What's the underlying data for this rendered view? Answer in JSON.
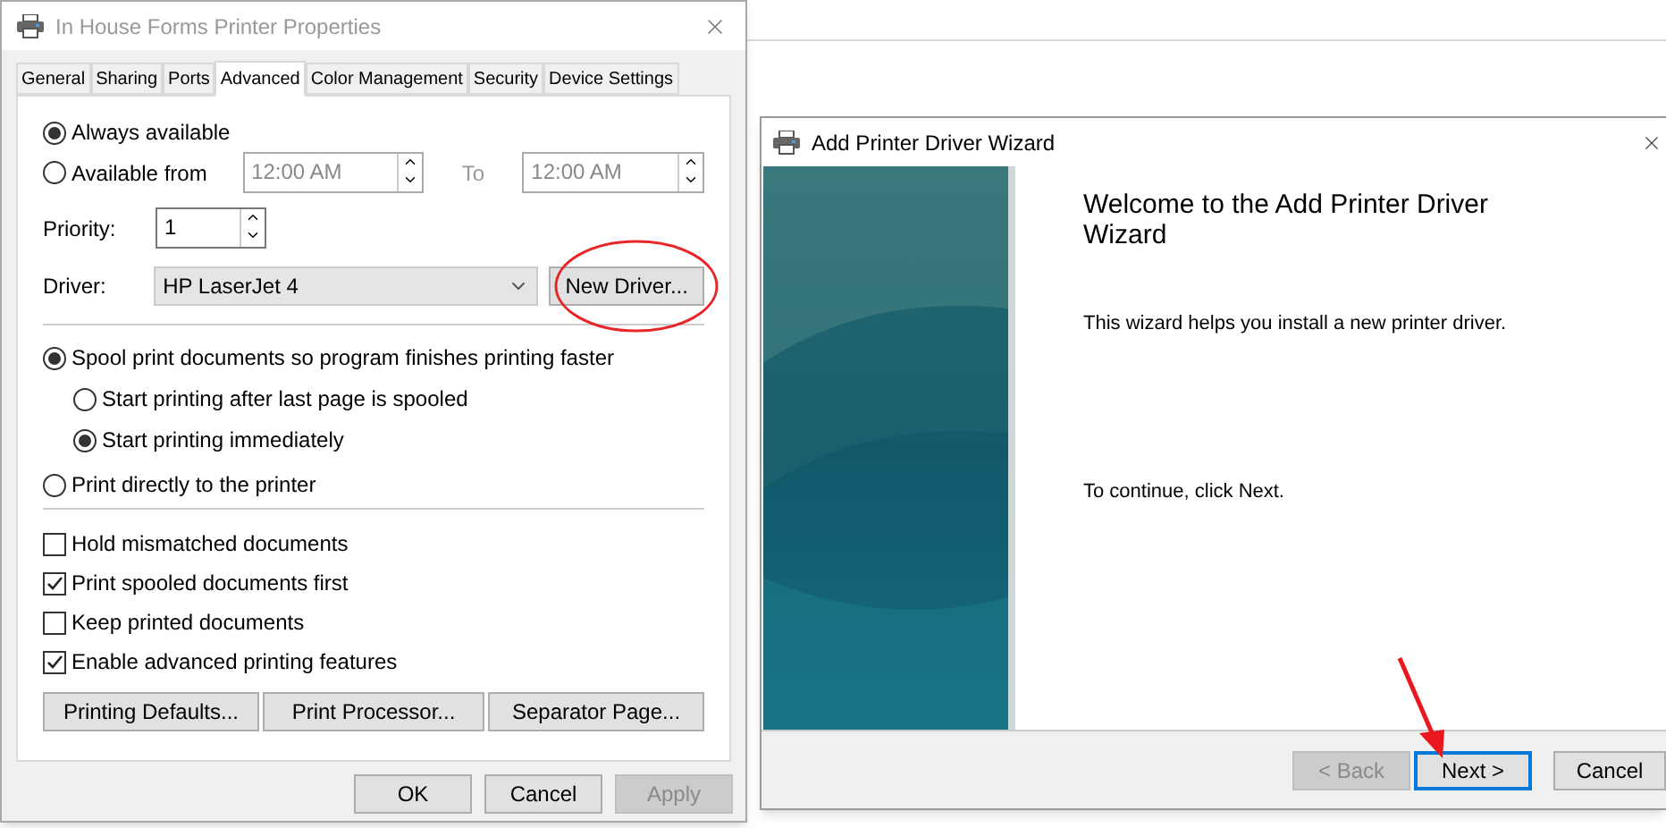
{
  "properties_window": {
    "title": "In House Forms Printer Properties",
    "tabs": [
      {
        "label": "General",
        "selected": false
      },
      {
        "label": "Sharing",
        "selected": false
      },
      {
        "label": "Ports",
        "selected": false
      },
      {
        "label": "Advanced",
        "selected": true
      },
      {
        "label": "Color Management",
        "selected": false
      },
      {
        "label": "Security",
        "selected": false
      },
      {
        "label": "Device Settings",
        "selected": false
      }
    ],
    "availability": [
      {
        "label": "Always available",
        "selected": true
      },
      {
        "label": "Available from",
        "selected": false
      }
    ],
    "from_time": "12:00 AM",
    "to_label": "To",
    "to_time": "12:00 AM",
    "priority_label": "Priority:",
    "priority": "1",
    "driver_label": "Driver:",
    "driver": "HP LaserJet 4",
    "new_driver_button": "New Driver...",
    "spool_options": [
      {
        "label": "Spool print documents so program finishes printing faster",
        "selected": true,
        "children": [
          {
            "label": "Start printing after last page is spooled",
            "selected": false
          },
          {
            "label": "Start printing immediately",
            "selected": true
          }
        ]
      },
      {
        "label": "Print directly to the printer",
        "selected": false
      }
    ],
    "checkboxes": [
      {
        "label": "Hold mismatched documents",
        "checked": false
      },
      {
        "label": "Print spooled documents first",
        "checked": true
      },
      {
        "label": "Keep printed documents",
        "checked": false
      },
      {
        "label": "Enable advanced printing features",
        "checked": true
      }
    ],
    "action_buttons": [
      "Printing Defaults...",
      "Print Processor...",
      "Separator Page..."
    ],
    "footer_buttons": [
      {
        "label": "OK",
        "disabled": false
      },
      {
        "label": "Cancel",
        "disabled": false
      },
      {
        "label": "Apply",
        "disabled": true
      }
    ]
  },
  "wizard_window": {
    "title": "Add Printer Driver Wizard",
    "heading": "Welcome to the Add Printer Driver Wizard",
    "body": "This wizard helps you install a new printer driver.",
    "hint": "To continue, click Next.",
    "buttons": [
      {
        "label": "< Back",
        "disabled": true,
        "focused": false
      },
      {
        "label": "Next >",
        "disabled": false,
        "focused": true
      },
      {
        "label": "Cancel",
        "disabled": false,
        "focused": false
      }
    ]
  }
}
